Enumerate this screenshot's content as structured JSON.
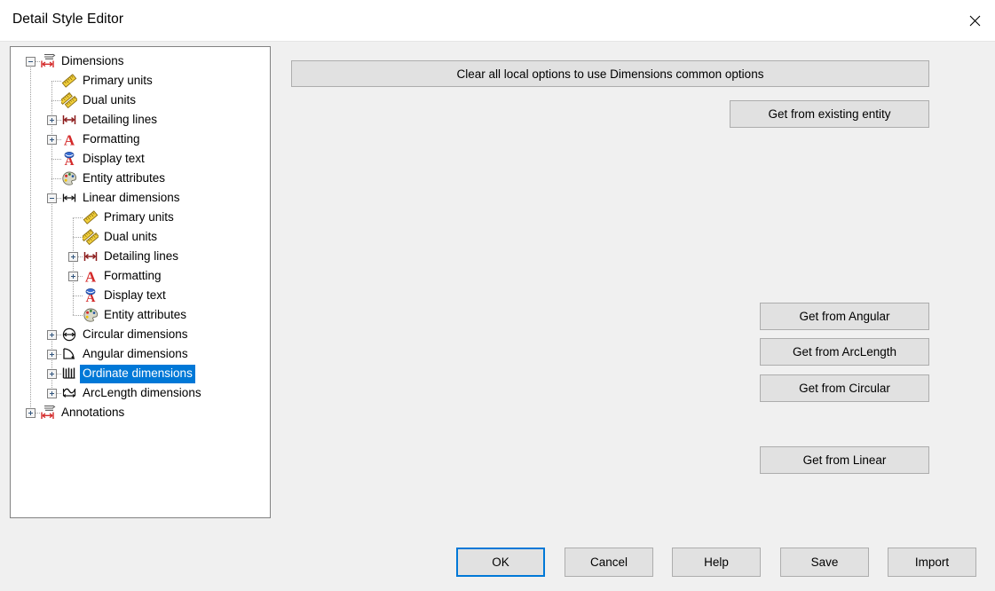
{
  "window": {
    "title": "Detail Style Editor",
    "close_icon": "close-icon"
  },
  "tree": {
    "items": [
      {
        "label": "Dimensions",
        "depth": 0,
        "expander": "minus",
        "icon": "dimensions-icon",
        "selected": false
      },
      {
        "label": "Primary units",
        "depth": 1,
        "expander": "none",
        "icon": "ruler-icon",
        "selected": false
      },
      {
        "label": "Dual units",
        "depth": 1,
        "expander": "none",
        "icon": "dual-ruler-icon",
        "selected": false
      },
      {
        "label": "Detailing lines",
        "depth": 1,
        "expander": "plus",
        "icon": "detailing-lines-icon",
        "selected": false
      },
      {
        "label": "Formatting",
        "depth": 1,
        "expander": "plus",
        "icon": "formatting-a-icon",
        "selected": false
      },
      {
        "label": "Display text",
        "depth": 1,
        "expander": "none",
        "icon": "display-text-icon",
        "selected": false
      },
      {
        "label": "Entity attributes",
        "depth": 1,
        "expander": "none",
        "icon": "palette-icon",
        "selected": false
      },
      {
        "label": "Linear dimensions",
        "depth": 1,
        "expander": "minus",
        "icon": "linear-dimension-icon",
        "selected": false
      },
      {
        "label": "Primary units",
        "depth": 2,
        "expander": "none",
        "icon": "ruler-icon",
        "selected": false
      },
      {
        "label": "Dual units",
        "depth": 2,
        "expander": "none",
        "icon": "dual-ruler-icon",
        "selected": false
      },
      {
        "label": "Detailing lines",
        "depth": 2,
        "expander": "plus",
        "icon": "detailing-lines-icon",
        "selected": false
      },
      {
        "label": "Formatting",
        "depth": 2,
        "expander": "plus",
        "icon": "formatting-a-icon",
        "selected": false
      },
      {
        "label": "Display text",
        "depth": 2,
        "expander": "none",
        "icon": "display-text-icon",
        "selected": false
      },
      {
        "label": "Entity attributes",
        "depth": 2,
        "expander": "none",
        "icon": "palette-icon",
        "selected": false
      },
      {
        "label": "Circular dimensions",
        "depth": 1,
        "expander": "plus",
        "icon": "circular-dimension-icon",
        "selected": false
      },
      {
        "label": "Angular dimensions",
        "depth": 1,
        "expander": "plus",
        "icon": "angular-dimension-icon",
        "selected": false
      },
      {
        "label": "Ordinate dimensions",
        "depth": 1,
        "expander": "plus",
        "icon": "ordinate-dimension-icon",
        "selected": true
      },
      {
        "label": "ArcLength dimensions",
        "depth": 1,
        "expander": "plus",
        "icon": "arclength-dimension-icon",
        "selected": false
      },
      {
        "label": "Annotations",
        "depth": 0,
        "expander": "plus",
        "icon": "dimensions-icon",
        "selected": false
      }
    ]
  },
  "main": {
    "clear_local_options_label": "Clear all local options to use Dimensions common options",
    "get_from_existing_entity_label": "Get from existing entity",
    "get_from_angular_label": "Get from Angular",
    "get_from_arclength_label": "Get from ArcLength",
    "get_from_circular_label": "Get from Circular",
    "get_from_linear_label": "Get from Linear"
  },
  "footer": {
    "ok_label": "OK",
    "cancel_label": "Cancel",
    "help_label": "Help",
    "save_label": "Save",
    "import_label": "Import"
  },
  "colors": {
    "selection_blue": "#0078d7",
    "window_background": "#f0f0f0",
    "titlebar_background": "#ffffff",
    "tree_background": "#ffffff",
    "button_face": "#e1e1e1",
    "icon_red": "#d42a2a",
    "icon_yellow": "#f2d03b"
  }
}
